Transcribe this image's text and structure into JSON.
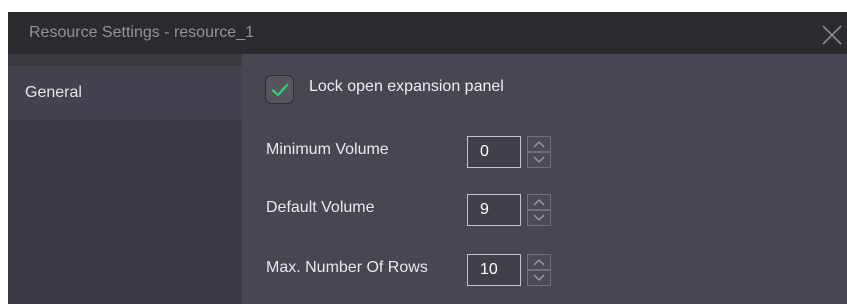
{
  "window": {
    "title": "Resource Settings - resource_1",
    "close_icon": "close-icon"
  },
  "sidebar": {
    "items": [
      {
        "label": "General",
        "active": true
      }
    ]
  },
  "main": {
    "lock_panel": {
      "label": "Lock open expansion panel",
      "checked": true,
      "check_color": "#2eca7a"
    },
    "fields": [
      {
        "label": "Minimum Volume",
        "value": "0"
      },
      {
        "label": "Default Volume",
        "value": "9"
      },
      {
        "label": "Max. Number Of Rows",
        "value": "10"
      }
    ]
  },
  "colors": {
    "title_bar": "#2b2b2f",
    "sidebar": "#3a3a42",
    "panel": "#474752",
    "accent": "#2eca7a"
  }
}
